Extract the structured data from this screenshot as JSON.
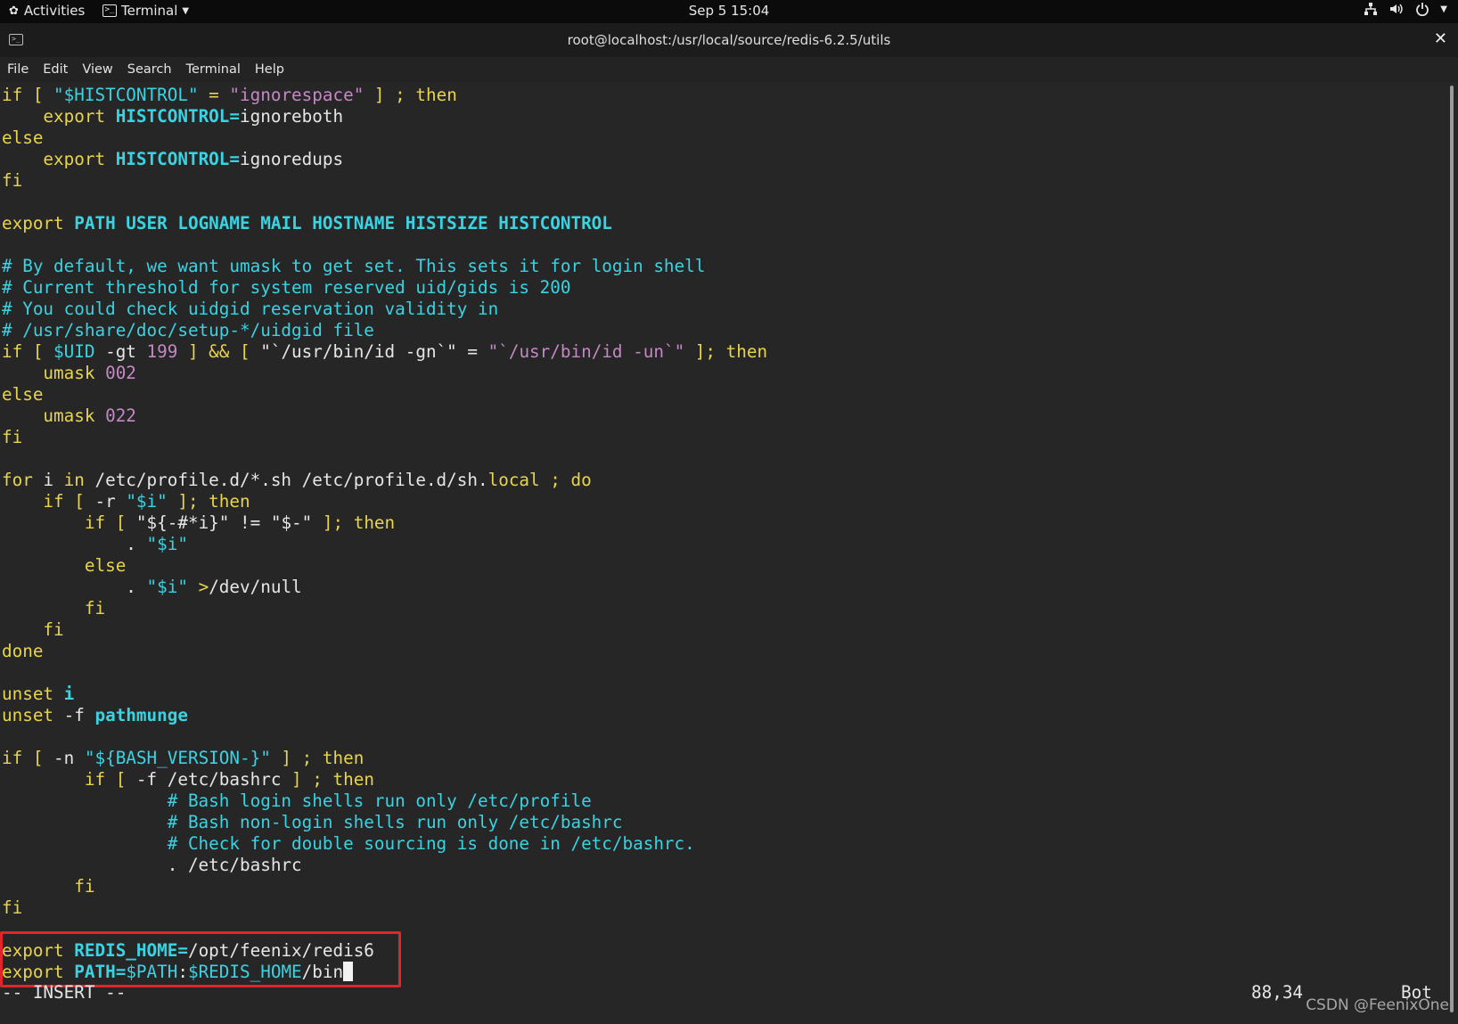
{
  "topbar": {
    "activities": "Activities",
    "app_name": "Terminal",
    "clock": "Sep 5  15:04"
  },
  "window": {
    "title": "root@localhost:/usr/local/source/redis-6.2.5/utils"
  },
  "menu": [
    "File",
    "Edit",
    "View",
    "Search",
    "Terminal",
    "Help"
  ],
  "terminal_lines": [
    [
      [
        "if [ ",
        "y"
      ],
      [
        "\"$HISTCONTROL\"",
        "c"
      ],
      [
        " = ",
        "y"
      ],
      [
        "\"ignorespace\"",
        "m"
      ],
      [
        " ] ; then",
        "y"
      ]
    ],
    [
      [
        "    export ",
        "y"
      ],
      [
        "HISTCONTROL=",
        "cb"
      ],
      [
        "ignoreboth",
        "w"
      ]
    ],
    [
      [
        "else",
        "y"
      ]
    ],
    [
      [
        "    export ",
        "y"
      ],
      [
        "HISTCONTROL=",
        "cb"
      ],
      [
        "ignoredups",
        "w"
      ]
    ],
    [
      [
        "fi",
        "y"
      ]
    ],
    [],
    [
      [
        "export ",
        "y"
      ],
      [
        "PATH USER LOGNAME MAIL HOSTNAME HISTSIZE HISTCONTROL",
        "cb"
      ]
    ],
    [],
    [
      [
        "# By default, we want umask to get set. This sets it for login shell",
        "c"
      ]
    ],
    [
      [
        "# Current threshold for system reserved uid/gids is 200",
        "c"
      ]
    ],
    [
      [
        "# You could check uidgid reservation validity in",
        "c"
      ]
    ],
    [
      [
        "# /usr/share/doc/setup-*/uidgid file",
        "c"
      ]
    ],
    [
      [
        "if [ ",
        "y"
      ],
      [
        "$UID",
        "c"
      ],
      [
        " -gt ",
        "w"
      ],
      [
        "199",
        "m"
      ],
      [
        " ] && [ ",
        "y"
      ],
      [
        "\"`",
        "w"
      ],
      [
        "/usr/bin/id -gn",
        "w"
      ],
      [
        "`\"",
        "w"
      ],
      [
        " = ",
        "w"
      ],
      [
        "\"`/usr/bin/id -un`\"",
        "m"
      ],
      [
        " ]; then",
        "y"
      ]
    ],
    [
      [
        "    umask ",
        "y"
      ],
      [
        "002",
        "m"
      ]
    ],
    [
      [
        "else",
        "y"
      ]
    ],
    [
      [
        "    umask ",
        "y"
      ],
      [
        "022",
        "m"
      ]
    ],
    [
      [
        "fi",
        "y"
      ]
    ],
    [],
    [
      [
        "for ",
        "y"
      ],
      [
        "i ",
        "w"
      ],
      [
        "in ",
        "y"
      ],
      [
        "/etc/profile.d/*.sh /etc/profile.d/sh.",
        "w"
      ],
      [
        "local",
        "y"
      ],
      [
        " ; do",
        "y"
      ]
    ],
    [
      [
        "    if [ ",
        "y"
      ],
      [
        "-r ",
        "w"
      ],
      [
        "\"$i\"",
        "c"
      ],
      [
        " ]; then",
        "y"
      ]
    ],
    [
      [
        "        if [ ",
        "y"
      ],
      [
        "\"${-#*i}\"",
        "w"
      ],
      [
        " != ",
        "w"
      ],
      [
        "\"$-\"",
        "w"
      ],
      [
        " ]; then",
        "y"
      ]
    ],
    [
      [
        "            . ",
        "w"
      ],
      [
        "\"$i\"",
        "c"
      ]
    ],
    [
      [
        "        else",
        "y"
      ]
    ],
    [
      [
        "            . ",
        "w"
      ],
      [
        "\"$i\"",
        "c"
      ],
      [
        " >",
        "y"
      ],
      [
        "/dev/null",
        "w"
      ]
    ],
    [
      [
        "        fi",
        "y"
      ]
    ],
    [
      [
        "    fi",
        "y"
      ]
    ],
    [
      [
        "done",
        "y"
      ]
    ],
    [],
    [
      [
        "unset ",
        "y"
      ],
      [
        "i",
        "cb"
      ]
    ],
    [
      [
        "unset ",
        "y"
      ],
      [
        "-f ",
        "w"
      ],
      [
        "pathmunge",
        "cb"
      ]
    ],
    [],
    [
      [
        "if [ ",
        "y"
      ],
      [
        "-n ",
        "w"
      ],
      [
        "\"${BASH_VERSION-}\"",
        "c"
      ],
      [
        " ] ; then",
        "y"
      ]
    ],
    [
      [
        "        if [ ",
        "y"
      ],
      [
        "-f ",
        "w"
      ],
      [
        "/etc/bashrc",
        "w"
      ],
      [
        " ] ; then",
        "y"
      ]
    ],
    [
      [
        "                # Bash login shells run only /etc/profile",
        "c"
      ]
    ],
    [
      [
        "                # Bash non-login shells run only /etc/bashrc",
        "c"
      ]
    ],
    [
      [
        "                # Check for double sourcing is done in /etc/bashrc.",
        "c"
      ]
    ],
    [
      [
        "                . /etc/bashrc",
        "w"
      ]
    ],
    [
      [
        "       fi",
        "y"
      ]
    ],
    [
      [
        "fi",
        "y"
      ]
    ],
    [],
    [
      [
        "export ",
        "y"
      ],
      [
        "REDIS_HOME=",
        "cb"
      ],
      [
        "/opt/feenix/redis6",
        "w"
      ]
    ],
    [
      [
        "export ",
        "y"
      ],
      [
        "PATH=",
        "cb"
      ],
      [
        "$PATH",
        "c"
      ],
      [
        ":",
        "w"
      ],
      [
        "$REDIS_HOME",
        "c"
      ],
      [
        "/bin",
        "w"
      ],
      [
        "",
        "cursor"
      ]
    ]
  ],
  "status": {
    "mode": "-- INSERT --",
    "position": "88,34",
    "scroll": "Bot"
  },
  "watermark": "CSDN @FeenixOne",
  "colors": {
    "keyword": "#e8d44d",
    "variable": "#39d3e3",
    "string": "#c488c4",
    "text": "#e6e6e6",
    "highlight": "#e0262a"
  }
}
